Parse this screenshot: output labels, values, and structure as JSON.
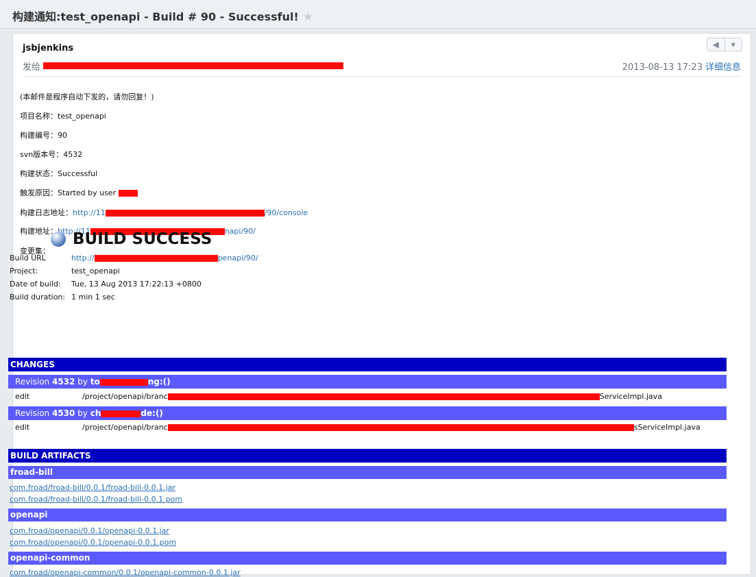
{
  "titlebar": {
    "subject": "构建通知:test_openapi - Build # 90 - Successful!",
    "star_icon": "star-icon"
  },
  "header": {
    "sender": "jsbjenkins",
    "to_label": "发给",
    "date": "2013-08-13 17:23",
    "details_link": "详细信息",
    "reply_icon": "reply-icon",
    "more_icon": "chevron-down-icon"
  },
  "intro": {
    "notice": "(本邮件是程序自动下发的，请勿回复！)",
    "project_name": "项目名称：test_openapi",
    "build_no": "构建编号：90",
    "svn_version": "svn版本号：4532",
    "build_status": "构建状态：Successful",
    "trigger": "触发原因：Started by user",
    "log_label": "构建日志地址：",
    "log_prefix": "http://11",
    "log_suffix": "/90/console",
    "build_label": "构建地址：",
    "build_prefix": "http://11",
    "build_suffix": "napi/90/",
    "changeset": "变更集："
  },
  "build": {
    "title": "BUILD SUCCESS",
    "url_label": "Build URL",
    "url_prefix": "http://",
    "url_suffix": "penapi/90/",
    "project_label": "Project:",
    "project_value": "test_openapi",
    "date_label": "Date of build:",
    "date_value": "Tue, 13 Aug 2013 17:22:13 +0800",
    "duration_label": "Build duration:",
    "duration_value": "1 min 1 sec"
  },
  "changes": {
    "title": "CHANGES",
    "revisions": [
      {
        "label": "Revision",
        "number": "4532",
        "by": "by",
        "author_prefix": "to",
        "author_suffix": "ng:()",
        "action": "edit",
        "path_prefix": "/project/openapi/branc",
        "path_suffix": "ServiceImpl.java"
      },
      {
        "label": "Revision",
        "number": "4530",
        "by": "by",
        "author_prefix": "ch",
        "author_suffix": "de:()",
        "action": "edit",
        "path_prefix": "/project/openapi/branc",
        "path_suffix": "sServiceImpl.java"
      }
    ]
  },
  "artifacts": {
    "title": "BUILD ARTIFACTS",
    "groups": [
      {
        "name": "froad-bill",
        "files": [
          "com.froad/froad-bill/0.0.1/froad-bill-0.0.1.jar",
          "com.froad/froad-bill/0.0.1/froad-bill-0.0.1.pom"
        ]
      },
      {
        "name": "openapi",
        "files": [
          "com.froad/openapi/0.0.1/openapi-0.0.1.jar",
          "com.froad/openapi/0.0.1/openapi-0.0.1.pom"
        ]
      },
      {
        "name": "openapi-common",
        "files": [
          "com.froad/openapi-common/0.0.1/openapi-common-0.0.1.jar"
        ]
      }
    ]
  },
  "colors": {
    "section_header": "#0000c0",
    "subheader": "#5a5aff",
    "link": "#2a6fb5",
    "redaction": "#ff0a0a"
  }
}
